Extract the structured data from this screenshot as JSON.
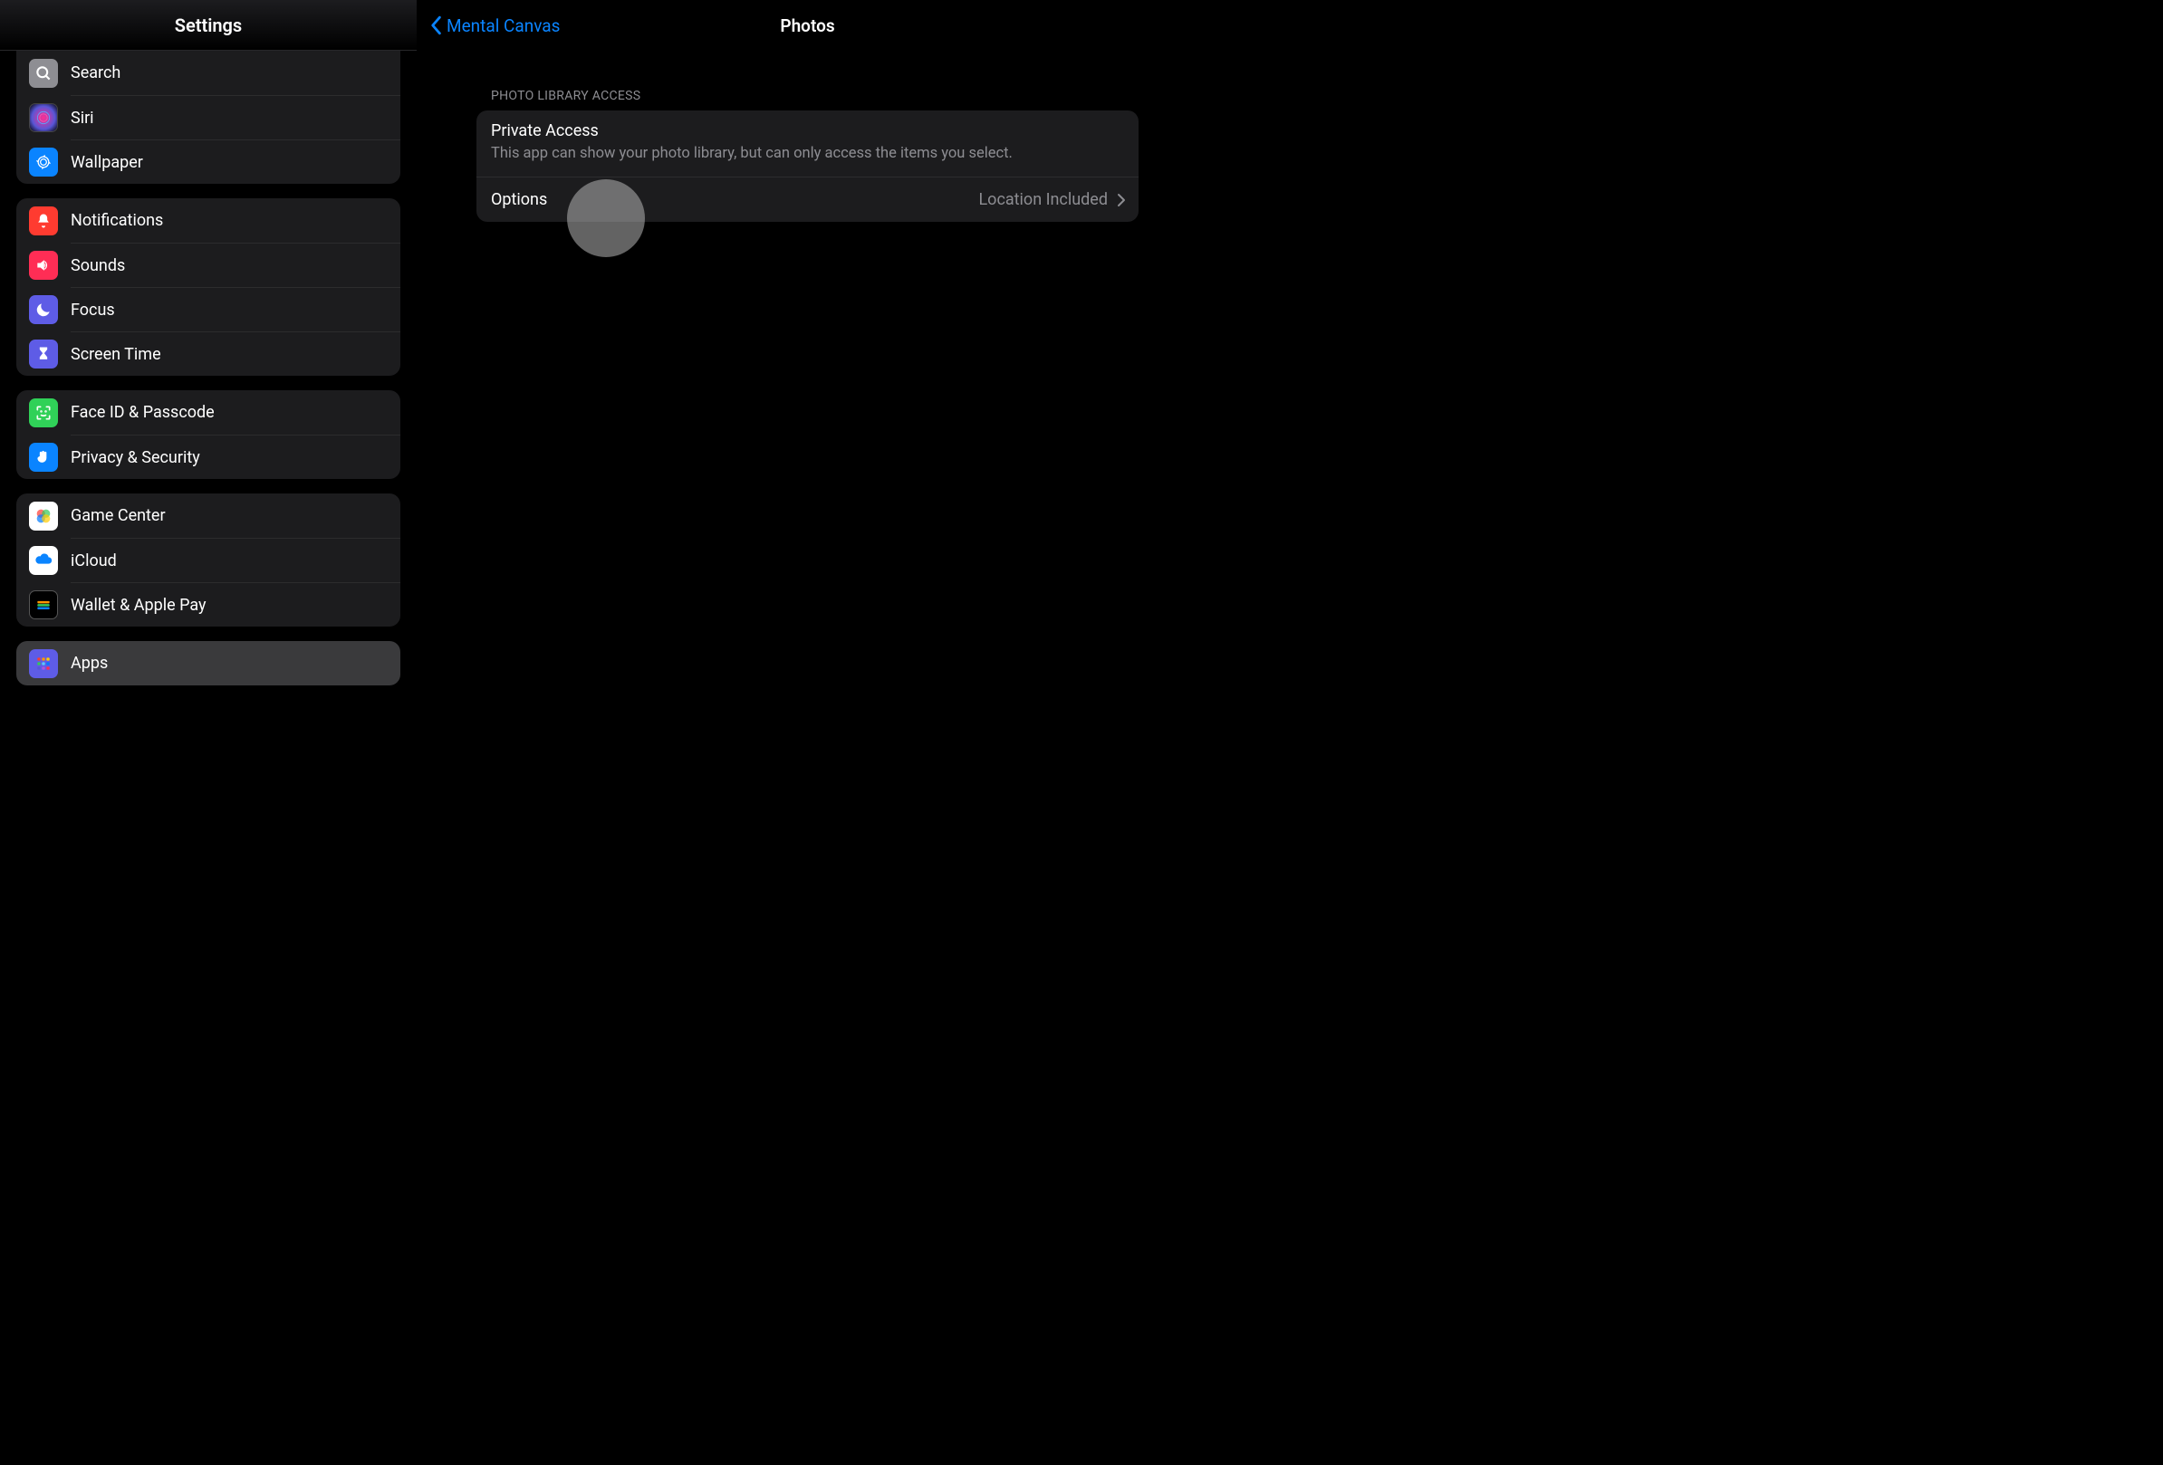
{
  "sidebar": {
    "title": "Settings",
    "groups": [
      {
        "items": [
          {
            "key": "search",
            "label": "Search"
          },
          {
            "key": "siri",
            "label": "Siri"
          },
          {
            "key": "wallpaper",
            "label": "Wallpaper"
          }
        ]
      },
      {
        "items": [
          {
            "key": "notifications",
            "label": "Notifications"
          },
          {
            "key": "sounds",
            "label": "Sounds"
          },
          {
            "key": "focus",
            "label": "Focus"
          },
          {
            "key": "screentime",
            "label": "Screen Time"
          }
        ]
      },
      {
        "items": [
          {
            "key": "faceid",
            "label": "Face ID & Passcode"
          },
          {
            "key": "privacy",
            "label": "Privacy & Security"
          }
        ]
      },
      {
        "items": [
          {
            "key": "gamecenter",
            "label": "Game Center"
          },
          {
            "key": "icloud",
            "label": "iCloud"
          },
          {
            "key": "wallet",
            "label": "Wallet & Apple Pay"
          }
        ]
      },
      {
        "items": [
          {
            "key": "apps",
            "label": "Apps",
            "selected": true
          }
        ]
      }
    ]
  },
  "detail": {
    "back_label": "Mental Canvas",
    "title": "Photos",
    "section_header": "PHOTO LIBRARY ACCESS",
    "private_access": {
      "title": "Private Access",
      "description": "This app can show your photo library, but can only access the items you select."
    },
    "options": {
      "label": "Options",
      "value": "Location Included"
    }
  }
}
